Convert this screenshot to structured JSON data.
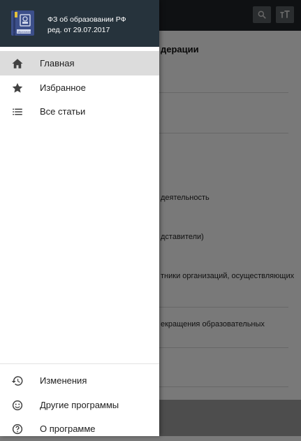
{
  "background": {
    "content_title": "дерации",
    "lines": [
      "деятельность",
      "дставители)",
      "тники организаций, осуществляющих",
      "екращения образовательных"
    ]
  },
  "drawer": {
    "header": {
      "app_title": "ФЗ об образовании РФ",
      "edition": "ред. от 29.07.2017",
      "book_caption": "об образовании"
    },
    "menu": [
      {
        "label": "Главная",
        "icon": "home-icon",
        "active": true
      },
      {
        "label": "Избранное",
        "icon": "star-icon",
        "active": false
      },
      {
        "label": "Все статьи",
        "icon": "list-icon",
        "active": false
      }
    ],
    "footer_menu": [
      {
        "label": "Изменения",
        "icon": "history-icon"
      },
      {
        "label": "Другие программы",
        "icon": "smile-icon"
      },
      {
        "label": "О программе",
        "icon": "help-icon"
      }
    ]
  },
  "colors": {
    "header_bg": "#26333c",
    "active_bg": "#dcdcdc",
    "icon_color": "#424242"
  }
}
